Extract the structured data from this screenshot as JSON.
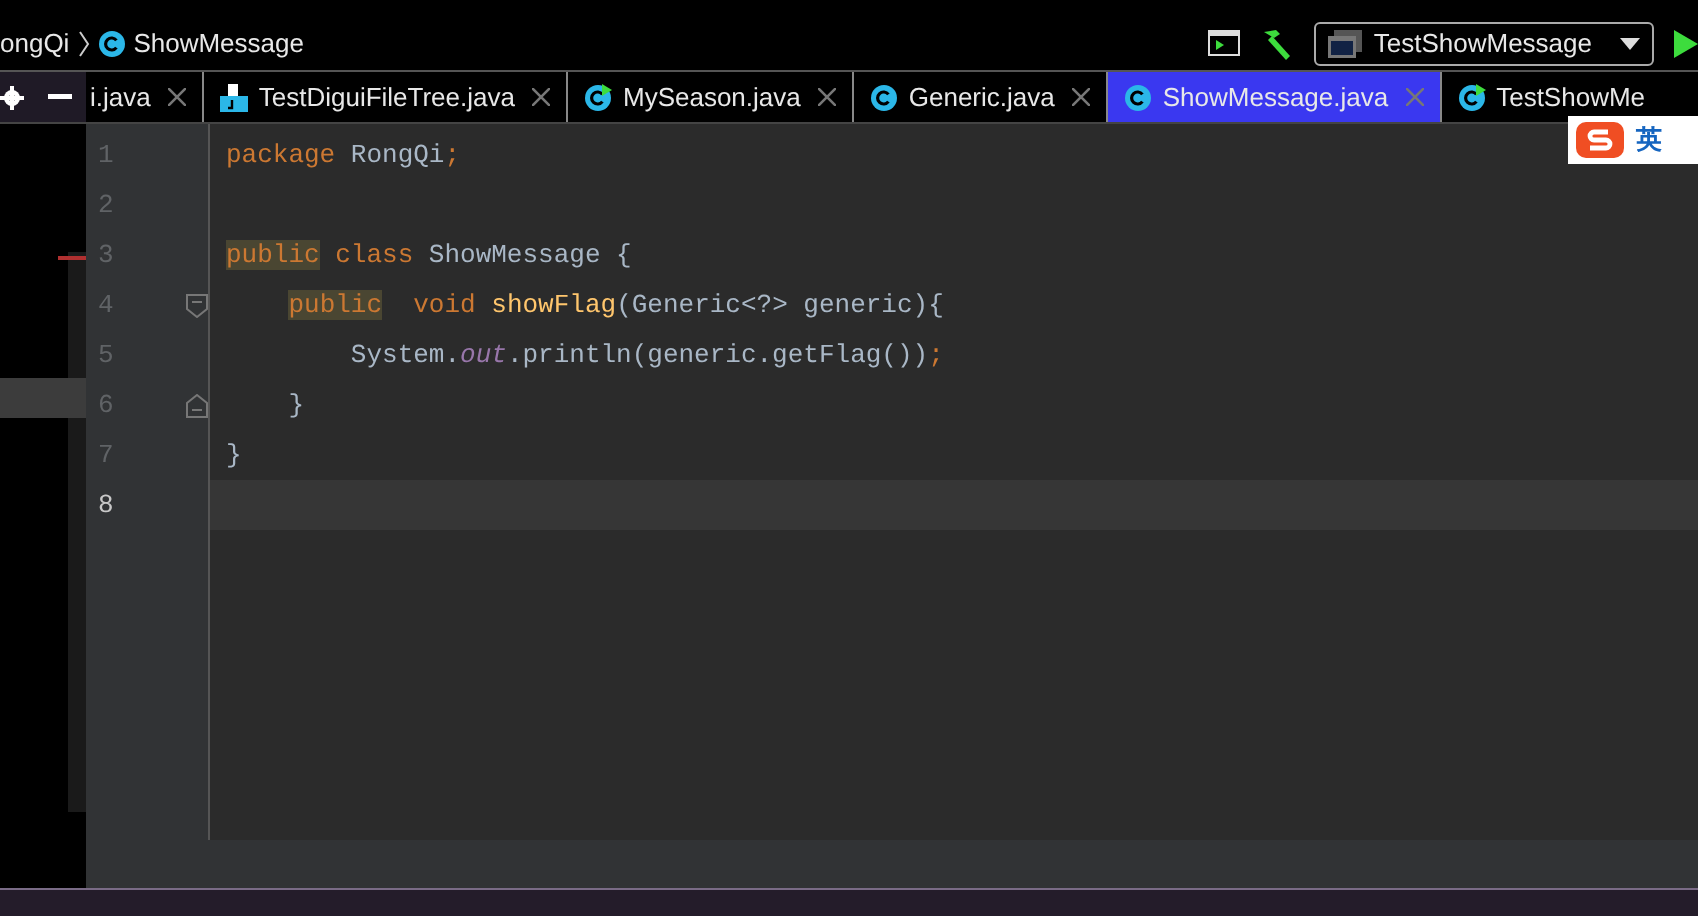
{
  "breadcrumb": [
    {
      "label": "ongQi",
      "kind": "package"
    },
    {
      "label": "ShowMessage",
      "kind": "class"
    }
  ],
  "toolbar": {
    "run_config": "TestShowMessage"
  },
  "tabs": [
    {
      "label": "i.java",
      "kind": "plain",
      "selected": false
    },
    {
      "label": "TestDiguiFileTree.java",
      "kind": "file",
      "selected": false
    },
    {
      "label": "MySeason.java",
      "kind": "runnable",
      "selected": false
    },
    {
      "label": "Generic.java",
      "kind": "class",
      "selected": false
    },
    {
      "label": "ShowMessage.java",
      "kind": "class",
      "selected": true
    },
    {
      "label": "TestShowMe",
      "kind": "runnable",
      "selected": false
    }
  ],
  "ime_indicator": {
    "label": "英"
  },
  "editor": {
    "lines": [
      {
        "number": "1",
        "kind": "code",
        "current": false,
        "tokens": [
          {
            "text": "package",
            "kind": "keyword"
          },
          {
            "text": " RongQi",
            "kind": "plain"
          },
          {
            "text": ";",
            "kind": "keyword"
          }
        ]
      },
      {
        "number": "2",
        "kind": "code",
        "current": false
      },
      {
        "number": "3",
        "kind": "code",
        "current": false,
        "tokens": [
          {
            "text": "public",
            "kind": "marked"
          },
          {
            "text": " class",
            "kind": "keyword"
          },
          {
            "text": " ShowMessage {",
            "kind": "plain"
          }
        ]
      },
      {
        "number": "4",
        "kind": "opener",
        "current": false,
        "tokens": [
          {
            "text": "    public",
            "kind": "marked"
          },
          {
            "text": "  void",
            "kind": "keyword"
          },
          {
            "text": " showFlag",
            "kind": "method"
          },
          {
            "text": "(Generic<?> generic){",
            "kind": "plain"
          }
        ]
      },
      {
        "number": "5",
        "kind": "code",
        "current": false,
        "tokens": [
          {
            "text": "        System.",
            "kind": "plain"
          },
          {
            "text": "out",
            "kind": "static"
          },
          {
            "text": ".println(generic.getFlag())",
            "kind": "plain"
          },
          {
            "text": ";",
            "kind": "keyword"
          }
        ]
      },
      {
        "number": "6",
        "kind": "closer",
        "current": false,
        "tokens": [
          {
            "text": "    }",
            "kind": "plain"
          }
        ]
      },
      {
        "number": "7",
        "kind": "code",
        "current": false,
        "tokens": [
          {
            "text": "}",
            "kind": "plain"
          }
        ]
      },
      {
        "number": "8",
        "kind": "code",
        "current": true
      }
    ]
  }
}
